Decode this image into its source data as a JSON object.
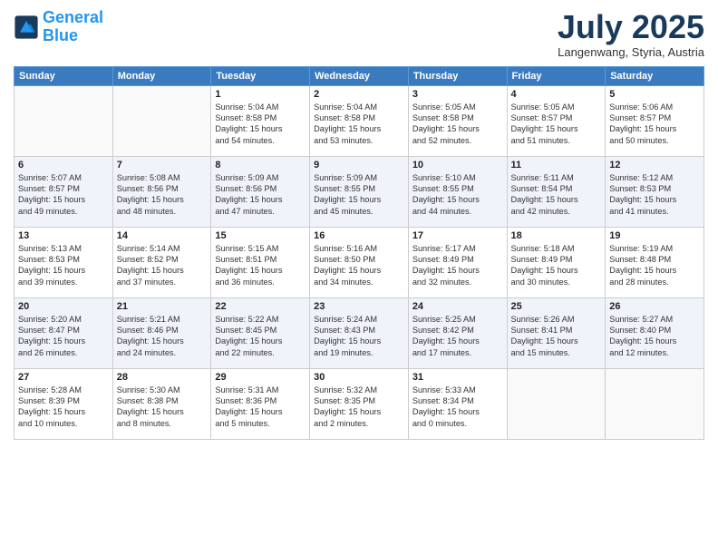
{
  "logo": {
    "line1": "General",
    "line2": "Blue"
  },
  "header": {
    "month": "July 2025",
    "location": "Langenwang, Styria, Austria"
  },
  "weekdays": [
    "Sunday",
    "Monday",
    "Tuesday",
    "Wednesday",
    "Thursday",
    "Friday",
    "Saturday"
  ],
  "weeks": [
    [
      {
        "num": "",
        "info": ""
      },
      {
        "num": "",
        "info": ""
      },
      {
        "num": "1",
        "info": "Sunrise: 5:04 AM\nSunset: 8:58 PM\nDaylight: 15 hours\nand 54 minutes."
      },
      {
        "num": "2",
        "info": "Sunrise: 5:04 AM\nSunset: 8:58 PM\nDaylight: 15 hours\nand 53 minutes."
      },
      {
        "num": "3",
        "info": "Sunrise: 5:05 AM\nSunset: 8:58 PM\nDaylight: 15 hours\nand 52 minutes."
      },
      {
        "num": "4",
        "info": "Sunrise: 5:05 AM\nSunset: 8:57 PM\nDaylight: 15 hours\nand 51 minutes."
      },
      {
        "num": "5",
        "info": "Sunrise: 5:06 AM\nSunset: 8:57 PM\nDaylight: 15 hours\nand 50 minutes."
      }
    ],
    [
      {
        "num": "6",
        "info": "Sunrise: 5:07 AM\nSunset: 8:57 PM\nDaylight: 15 hours\nand 49 minutes."
      },
      {
        "num": "7",
        "info": "Sunrise: 5:08 AM\nSunset: 8:56 PM\nDaylight: 15 hours\nand 48 minutes."
      },
      {
        "num": "8",
        "info": "Sunrise: 5:09 AM\nSunset: 8:56 PM\nDaylight: 15 hours\nand 47 minutes."
      },
      {
        "num": "9",
        "info": "Sunrise: 5:09 AM\nSunset: 8:55 PM\nDaylight: 15 hours\nand 45 minutes."
      },
      {
        "num": "10",
        "info": "Sunrise: 5:10 AM\nSunset: 8:55 PM\nDaylight: 15 hours\nand 44 minutes."
      },
      {
        "num": "11",
        "info": "Sunrise: 5:11 AM\nSunset: 8:54 PM\nDaylight: 15 hours\nand 42 minutes."
      },
      {
        "num": "12",
        "info": "Sunrise: 5:12 AM\nSunset: 8:53 PM\nDaylight: 15 hours\nand 41 minutes."
      }
    ],
    [
      {
        "num": "13",
        "info": "Sunrise: 5:13 AM\nSunset: 8:53 PM\nDaylight: 15 hours\nand 39 minutes."
      },
      {
        "num": "14",
        "info": "Sunrise: 5:14 AM\nSunset: 8:52 PM\nDaylight: 15 hours\nand 37 minutes."
      },
      {
        "num": "15",
        "info": "Sunrise: 5:15 AM\nSunset: 8:51 PM\nDaylight: 15 hours\nand 36 minutes."
      },
      {
        "num": "16",
        "info": "Sunrise: 5:16 AM\nSunset: 8:50 PM\nDaylight: 15 hours\nand 34 minutes."
      },
      {
        "num": "17",
        "info": "Sunrise: 5:17 AM\nSunset: 8:49 PM\nDaylight: 15 hours\nand 32 minutes."
      },
      {
        "num": "18",
        "info": "Sunrise: 5:18 AM\nSunset: 8:49 PM\nDaylight: 15 hours\nand 30 minutes."
      },
      {
        "num": "19",
        "info": "Sunrise: 5:19 AM\nSunset: 8:48 PM\nDaylight: 15 hours\nand 28 minutes."
      }
    ],
    [
      {
        "num": "20",
        "info": "Sunrise: 5:20 AM\nSunset: 8:47 PM\nDaylight: 15 hours\nand 26 minutes."
      },
      {
        "num": "21",
        "info": "Sunrise: 5:21 AM\nSunset: 8:46 PM\nDaylight: 15 hours\nand 24 minutes."
      },
      {
        "num": "22",
        "info": "Sunrise: 5:22 AM\nSunset: 8:45 PM\nDaylight: 15 hours\nand 22 minutes."
      },
      {
        "num": "23",
        "info": "Sunrise: 5:24 AM\nSunset: 8:43 PM\nDaylight: 15 hours\nand 19 minutes."
      },
      {
        "num": "24",
        "info": "Sunrise: 5:25 AM\nSunset: 8:42 PM\nDaylight: 15 hours\nand 17 minutes."
      },
      {
        "num": "25",
        "info": "Sunrise: 5:26 AM\nSunset: 8:41 PM\nDaylight: 15 hours\nand 15 minutes."
      },
      {
        "num": "26",
        "info": "Sunrise: 5:27 AM\nSunset: 8:40 PM\nDaylight: 15 hours\nand 12 minutes."
      }
    ],
    [
      {
        "num": "27",
        "info": "Sunrise: 5:28 AM\nSunset: 8:39 PM\nDaylight: 15 hours\nand 10 minutes."
      },
      {
        "num": "28",
        "info": "Sunrise: 5:30 AM\nSunset: 8:38 PM\nDaylight: 15 hours\nand 8 minutes."
      },
      {
        "num": "29",
        "info": "Sunrise: 5:31 AM\nSunset: 8:36 PM\nDaylight: 15 hours\nand 5 minutes."
      },
      {
        "num": "30",
        "info": "Sunrise: 5:32 AM\nSunset: 8:35 PM\nDaylight: 15 hours\nand 2 minutes."
      },
      {
        "num": "31",
        "info": "Sunrise: 5:33 AM\nSunset: 8:34 PM\nDaylight: 15 hours\nand 0 minutes."
      },
      {
        "num": "",
        "info": ""
      },
      {
        "num": "",
        "info": ""
      }
    ]
  ]
}
